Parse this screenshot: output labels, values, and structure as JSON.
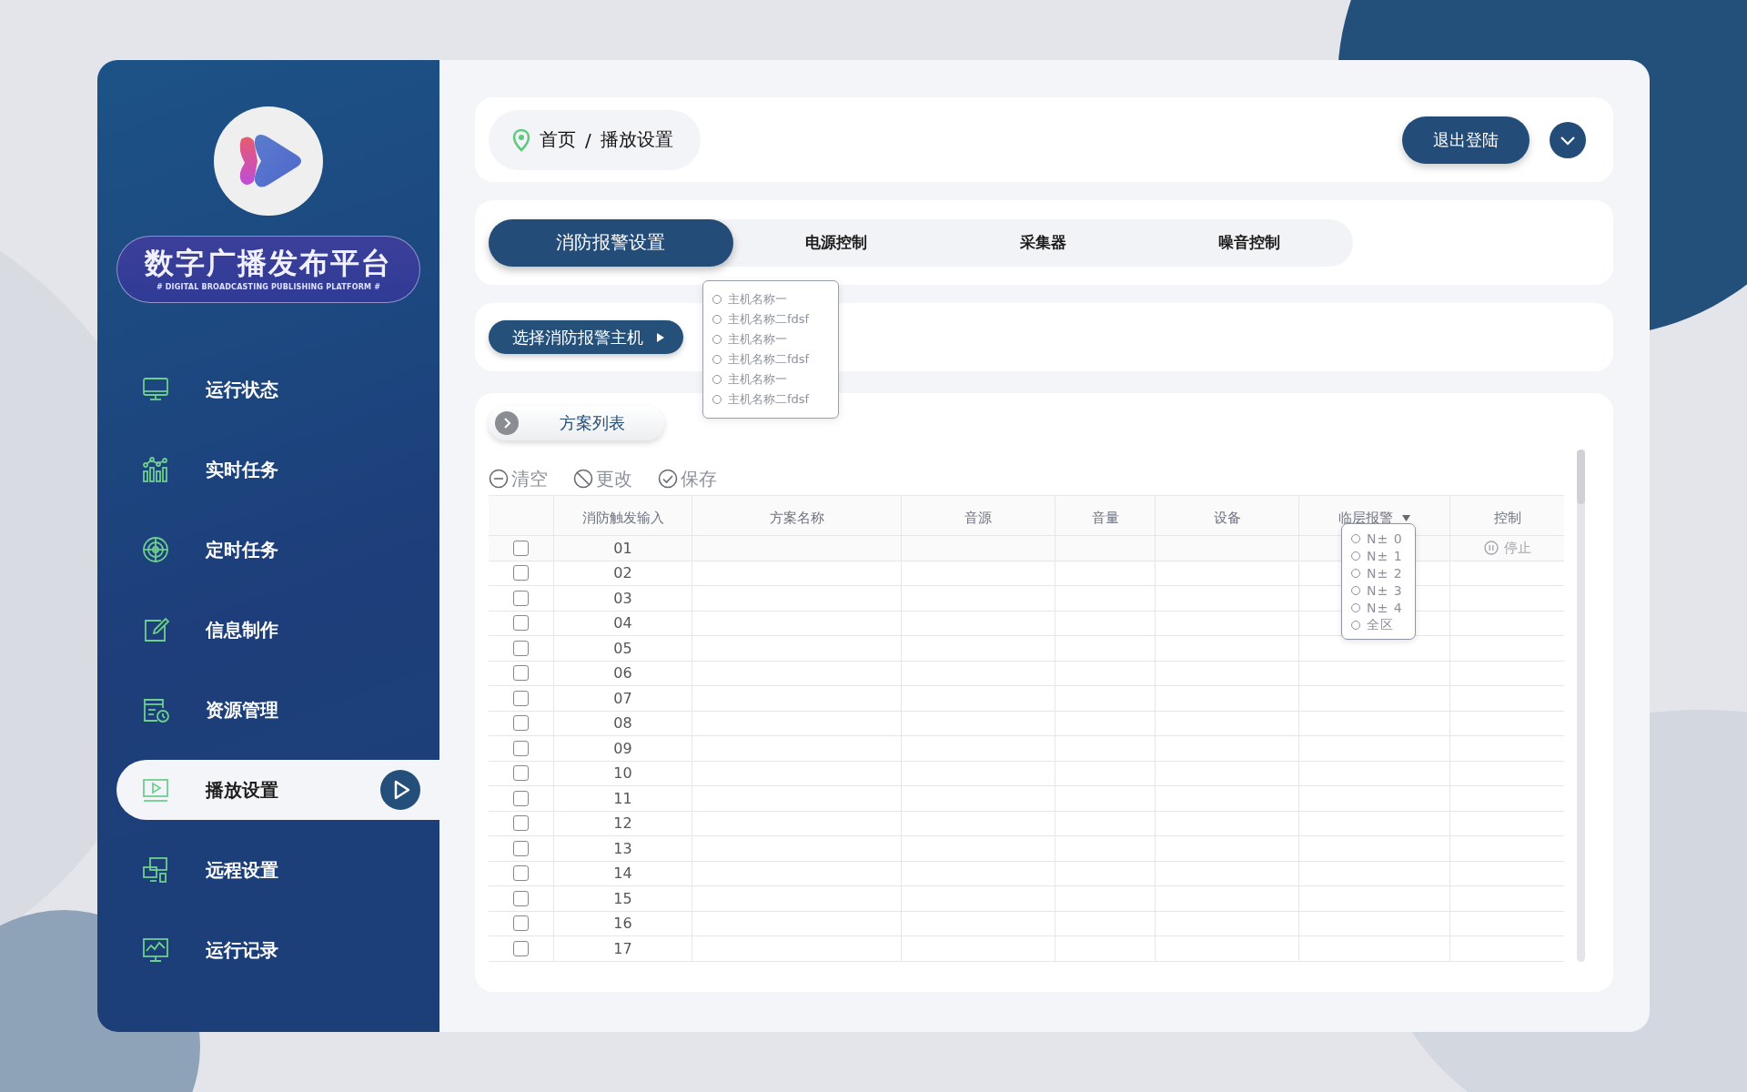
{
  "sidebar": {
    "logo_title": "数字广播发布平台",
    "logo_subtitle": "# DIGITAL BROADCASTING PUBLISHING PLATFORM #",
    "items": [
      {
        "label": "运行状态",
        "kind": "monitor",
        "selected": false
      },
      {
        "label": "实时任务",
        "kind": "chart",
        "selected": false
      },
      {
        "label": "定时任务",
        "kind": "target",
        "selected": false
      },
      {
        "label": "信息制作",
        "kind": "edit",
        "selected": false
      },
      {
        "label": "资源管理",
        "kind": "resource",
        "selected": false
      },
      {
        "label": "播放设置",
        "kind": "play",
        "selected": true
      },
      {
        "label": "远程设置",
        "kind": "remote",
        "selected": false
      },
      {
        "label": "运行记录",
        "kind": "record",
        "selected": false
      }
    ]
  },
  "breadcrumb": {
    "home": "首页",
    "separator": "/",
    "current": "播放设置"
  },
  "logout": "退出登陆",
  "tabs": [
    {
      "label": "消防报警设置",
      "selected": true
    },
    {
      "label": "电源控制",
      "selected": false
    },
    {
      "label": "采集器",
      "selected": false
    },
    {
      "label": "噪音控制",
      "selected": false
    }
  ],
  "host_button": "选择消防报警主机",
  "host_menu": [
    {
      "label": "主机名称一",
      "selected": false
    },
    {
      "label": "主机名称二fdsf",
      "selected": false
    },
    {
      "label": "主机名称一",
      "selected": false
    },
    {
      "label": "主机名称二fdsf",
      "selected": false
    },
    {
      "label": "主机名称一",
      "selected": false
    },
    {
      "label": "主机名称二fdsf",
      "selected": false
    }
  ],
  "plan_list": "方案列表",
  "toolbar": [
    {
      "kind": "clear",
      "label": "清空"
    },
    {
      "kind": "change",
      "label": "更改"
    },
    {
      "kind": "save",
      "label": "保存"
    }
  ],
  "table": {
    "columns": [
      "消防触发输入",
      "方案名称",
      "音源",
      "音量",
      "设备",
      "临层报警",
      "控制"
    ],
    "rows": [
      {
        "input": "01",
        "checked": false,
        "control": "停止"
      },
      {
        "input": "02",
        "checked": false
      },
      {
        "input": "03",
        "checked": false
      },
      {
        "input": "04",
        "checked": false
      },
      {
        "input": "05",
        "checked": false
      },
      {
        "input": "06",
        "checked": false
      },
      {
        "input": "07",
        "checked": false
      },
      {
        "input": "08",
        "checked": false
      },
      {
        "input": "09",
        "checked": false
      },
      {
        "input": "10",
        "checked": false
      },
      {
        "input": "11",
        "checked": false
      },
      {
        "input": "12",
        "checked": false
      },
      {
        "input": "13",
        "checked": false
      },
      {
        "input": "14",
        "checked": false
      },
      {
        "input": "15",
        "checked": false
      },
      {
        "input": "16",
        "checked": false
      },
      {
        "input": "17",
        "checked": false
      }
    ]
  },
  "layer_menu": [
    {
      "label": "N± 0",
      "selected": false
    },
    {
      "label": "N± 1",
      "selected": false
    },
    {
      "label": "N± 2",
      "selected": false
    },
    {
      "label": "N± 3",
      "selected": false
    },
    {
      "label": "N± 4",
      "selected": false
    },
    {
      "label": "全区",
      "selected": false
    }
  ]
}
